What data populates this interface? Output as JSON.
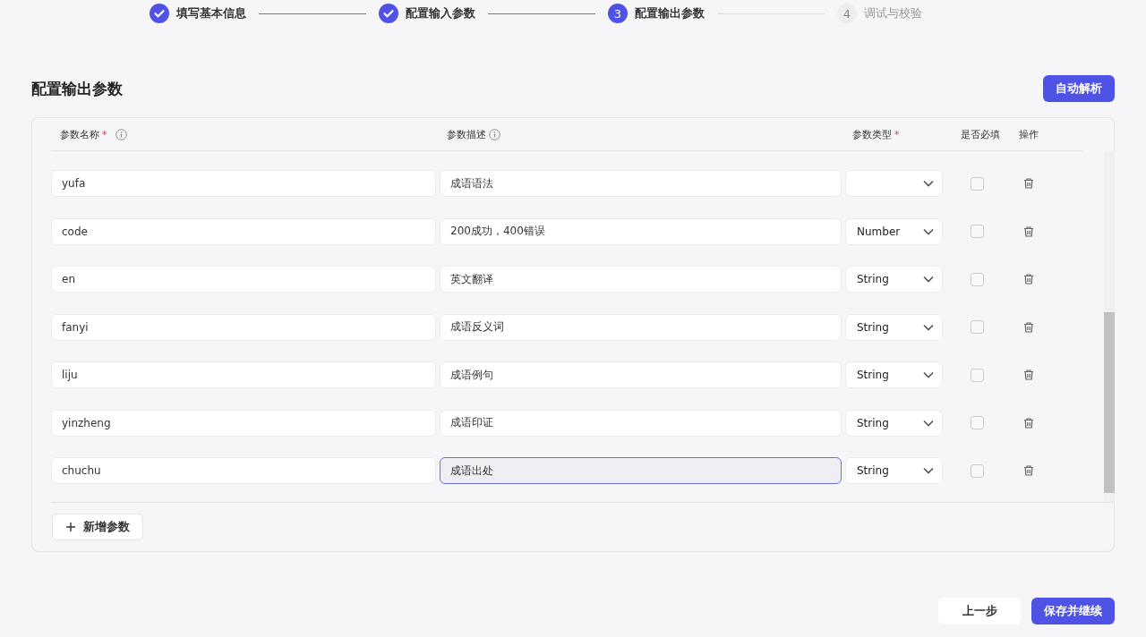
{
  "steps": [
    {
      "label": "填写基本信息",
      "kind": "done"
    },
    {
      "label": "配置输入参数",
      "kind": "done"
    },
    {
      "number": "3",
      "label": "配置输出参数",
      "kind": "current"
    },
    {
      "number": "4",
      "label": "调试与校验",
      "kind": "pending"
    }
  ],
  "section_title": "配置输出参数",
  "auto_parse_button": "自动解析",
  "table": {
    "columns": [
      {
        "label": "参数名称",
        "required_mark": "*",
        "info": true
      },
      {
        "label": "参数描述",
        "info": true
      },
      {
        "label": "参数类型",
        "required_mark": "*",
        "info": false
      },
      {
        "label": "是否必填",
        "info": false
      },
      {
        "label": "操作",
        "info": false
      }
    ],
    "rows": [
      {
        "name": "yufa",
        "description": "成语语法",
        "type": "",
        "required": false,
        "focused": false
      },
      {
        "name": "code",
        "description": "200成功，400错误",
        "type": "Number",
        "required": false,
        "focused": false
      },
      {
        "name": "en",
        "description": "英文翻译",
        "type": "String",
        "required": false,
        "focused": false
      },
      {
        "name": "fanyi",
        "description": "成语反义词",
        "type": "String",
        "required": false,
        "focused": false
      },
      {
        "name": "liju",
        "description": "成语例句",
        "type": "String",
        "required": false,
        "focused": false
      },
      {
        "name": "yinzheng",
        "description": "成语印证",
        "type": "String",
        "required": false,
        "focused": false
      },
      {
        "name": "chuchu",
        "description": "成语出处",
        "type": "String",
        "required": false,
        "focused": true
      }
    ]
  },
  "add_button": "新增参数",
  "footer_buttons": [
    {
      "label": "上一步",
      "kind": "secondary"
    },
    {
      "label": "保存并继续",
      "kind": "primary"
    }
  ]
}
